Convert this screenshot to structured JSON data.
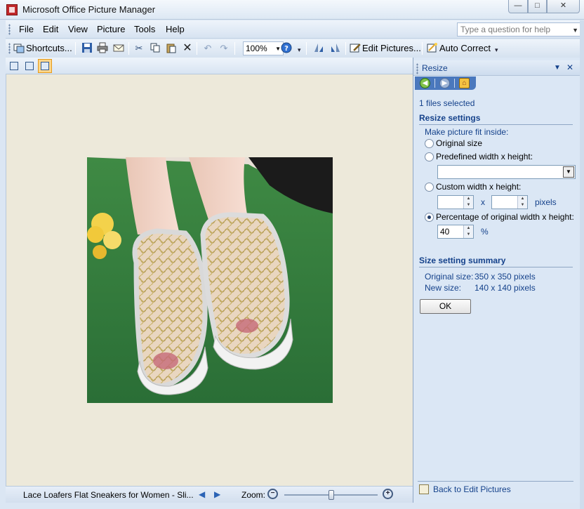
{
  "window": {
    "title": "Microsoft Office Picture Manager",
    "minimize_label": "—",
    "maximize_label": "□",
    "close_label": "✕"
  },
  "menu": {
    "items": [
      "File",
      "Edit",
      "View",
      "Picture",
      "Tools",
      "Help"
    ],
    "help_placeholder": "Type a question for help"
  },
  "toolbar": {
    "shortcuts_label": "Shortcuts...",
    "zoom_value": "100%",
    "edit_pictures_label": "Edit Pictures...",
    "auto_correct_label": "Auto Correct"
  },
  "view_modes": [
    "thumbnail-view",
    "filmstrip-view",
    "single-picture-view"
  ],
  "status": {
    "filename": "Lace Loafers Flat Sneakers for Women - Sli...",
    "zoom_label": "Zoom:",
    "zoom_level": 0.5
  },
  "pane": {
    "title": "Resize",
    "files_selected": "1 files selected",
    "resize_settings_heading": "Resize settings",
    "fit_inside_label": "Make picture fit inside:",
    "option_original": "Original size",
    "option_predefined": "Predefined width x height:",
    "option_custom": "Custom width x height:",
    "custom_x": "x",
    "custom_units": "pixels",
    "option_percentage": "Percentage of original width x height:",
    "percentage_value": "40",
    "percentage_units": "%",
    "summary_heading": "Size setting summary",
    "original_size_label": "Original size:",
    "original_size_value": "350 x 350 pixels",
    "new_size_label": "New size:",
    "new_size_value": "140 x 140 pixels",
    "ok_label": "OK",
    "back_link": "Back to Edit Pictures",
    "selected_option": "percentage"
  }
}
